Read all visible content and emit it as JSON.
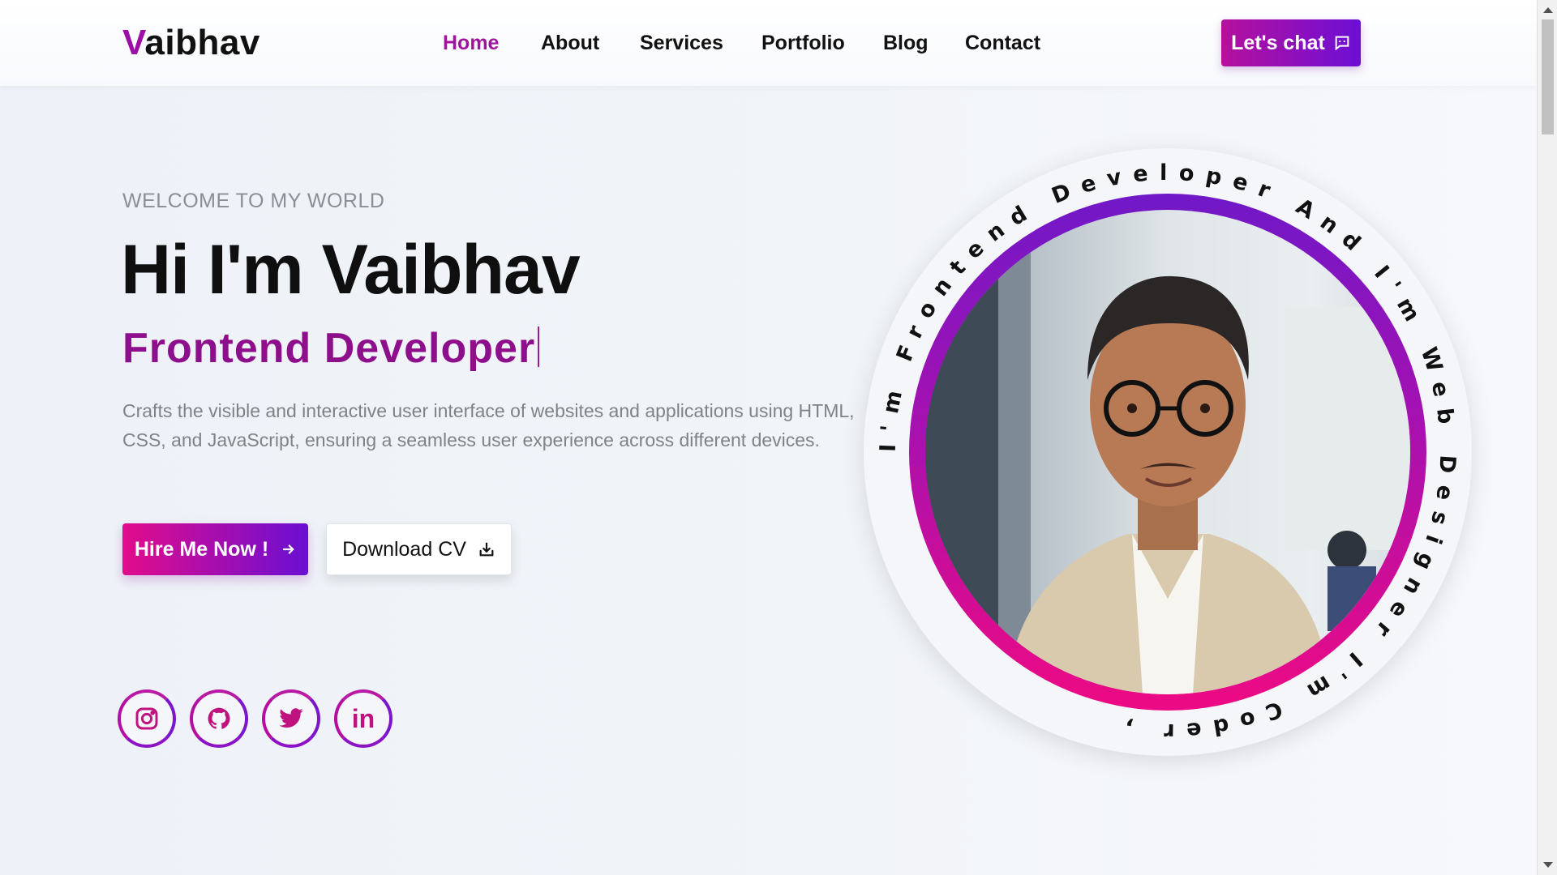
{
  "brand": {
    "logo_first": "V",
    "logo_rest": "aibhav"
  },
  "nav": {
    "items": [
      {
        "label": "Home",
        "active": true
      },
      {
        "label": "About",
        "active": false
      },
      {
        "label": "Services",
        "active": false
      },
      {
        "label": "Portfolio",
        "active": false
      },
      {
        "label": "Blog",
        "active": false
      },
      {
        "label": "Contact",
        "active": false
      }
    ],
    "chat_label": "Let's chat",
    "chat_icon": "chat-bubble-icon"
  },
  "hero": {
    "welcome": "WELCOME TO MY WORLD",
    "headline": "Hi I'm Vaibhav",
    "role": "Frontend Developer",
    "description": "Crafts the visible and interactive user interface of websites and applications using HTML, CSS, and JavaScript, ensuring a seamless user experience across different devices.",
    "hire_label": "Hire Me Now !",
    "hire_icon": "arrow-right-icon",
    "cv_label": "Download CV",
    "cv_icon": "download-icon"
  },
  "socials": [
    {
      "name": "instagram",
      "icon": "instagram-icon"
    },
    {
      "name": "github",
      "icon": "github-icon"
    },
    {
      "name": "twitter",
      "icon": "twitter-icon"
    },
    {
      "name": "linkedin",
      "icon": "linkedin-icon",
      "text": "in"
    }
  ],
  "ring_text": "I'm Frontend Developer And I'm Web Designer I'm Coder ,",
  "colors": {
    "accent_pink": "#e20c8b",
    "accent_purple": "#6a0fd2",
    "logo_accent": "#9c0fa5"
  }
}
